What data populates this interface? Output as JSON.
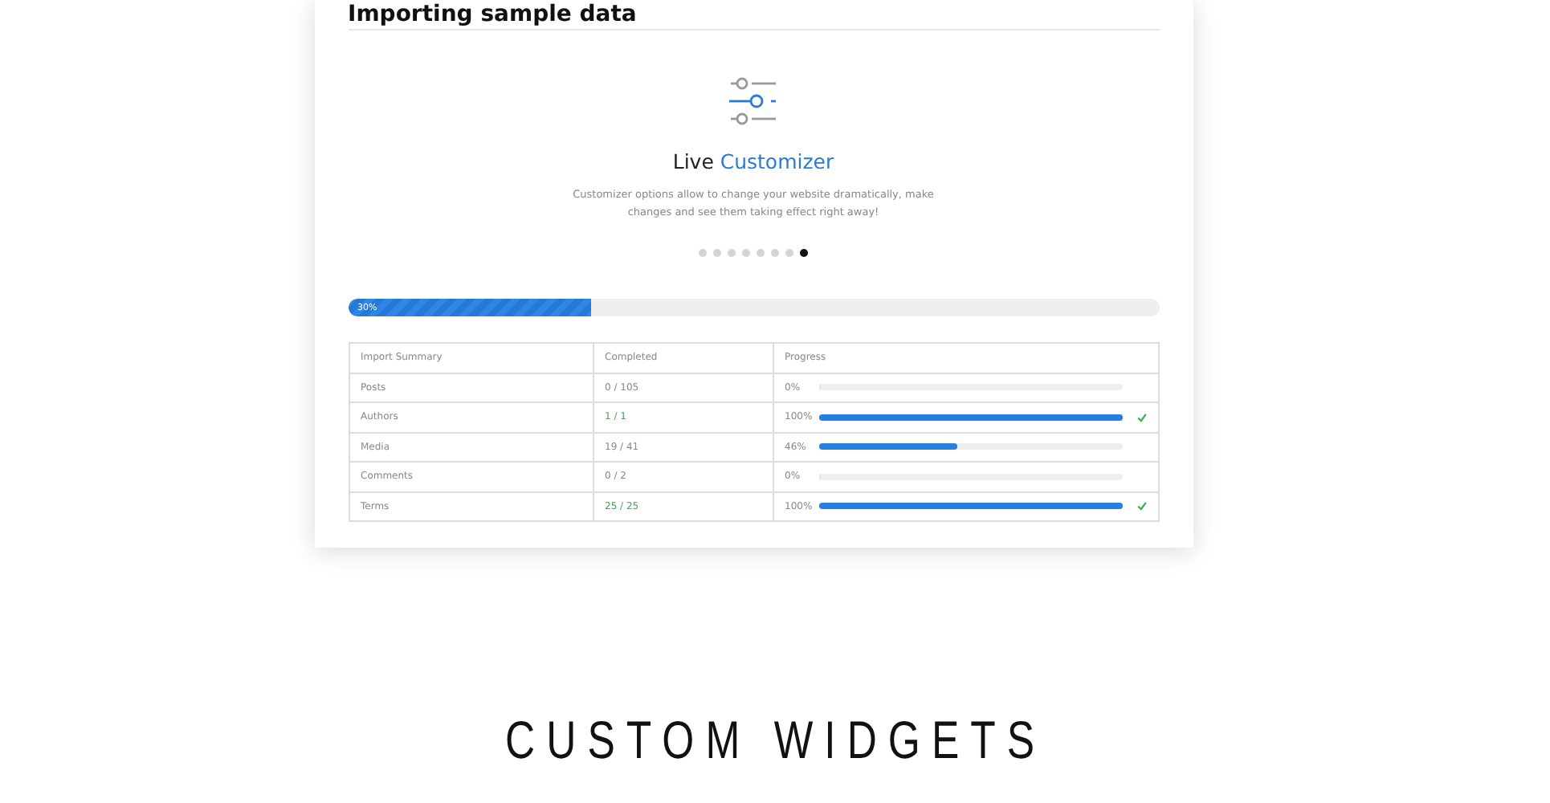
{
  "card": {
    "title": "Importing sample data",
    "slide": {
      "title_plain": "Live",
      "title_accent": "Customizer",
      "description": "Customizer options allow to change your website dramatically, make changes and see them taking effect right away!"
    },
    "dots": [
      {
        "selected": false
      },
      {
        "selected": false
      },
      {
        "selected": false
      },
      {
        "selected": false
      },
      {
        "selected": false
      },
      {
        "selected": false
      },
      {
        "selected": false
      },
      {
        "selected": true
      }
    ],
    "overall": {
      "level": 0.3,
      "reading": "30%"
    },
    "table": {
      "columns": [
        "Import Summary",
        "Completed",
        "Progress"
      ],
      "rows": [
        {
          "name": "Posts",
          "completed": "0 / 105",
          "percent": "0%",
          "level": 0,
          "done": false
        },
        {
          "name": "Authors",
          "completed": "1 / 1",
          "percent": "100%",
          "level": 1,
          "done": true
        },
        {
          "name": "Media",
          "completed": "19 / 41",
          "percent": "46%",
          "level": 0.46,
          "done": false
        },
        {
          "name": "Comments",
          "completed": "0 / 2",
          "percent": "0%",
          "level": 0,
          "done": false
        },
        {
          "name": "Terms",
          "completed": "25 / 25",
          "percent": "100%",
          "level": 1,
          "done": true
        }
      ]
    }
  },
  "heading": "CUSTOM WIDGETS"
}
